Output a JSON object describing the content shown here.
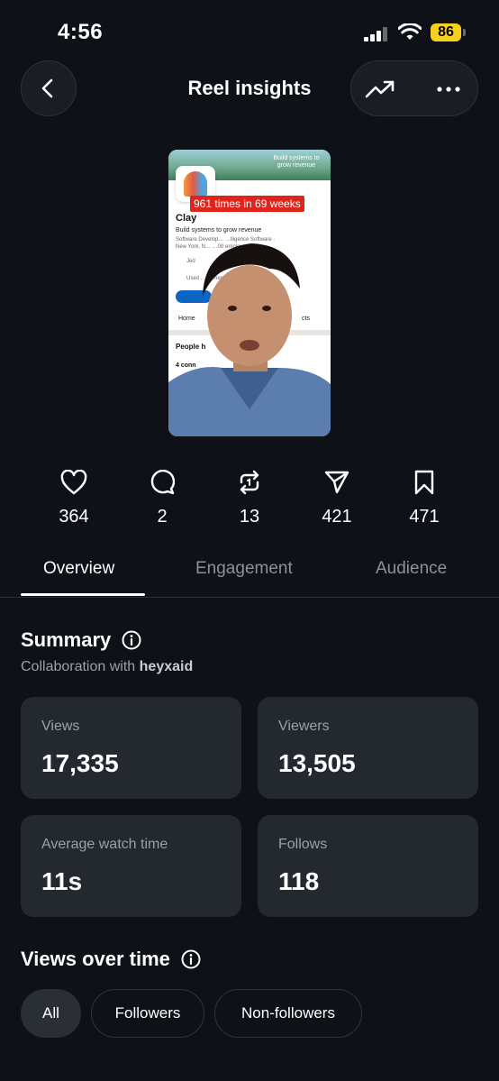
{
  "status_bar": {
    "time": "4:56",
    "battery": "86"
  },
  "header": {
    "title": "Reel insights",
    "back_icon": "chevron-left-icon",
    "trend_icon": "trending-up-icon",
    "more_icon": "more-horizontal-icon"
  },
  "thumbnail": {
    "banner_text": "Build systems to grow revenue",
    "badge": "961 times in 69 weeks",
    "company_name": "Clay",
    "tagline": "Build systems to grow revenue",
    "line1": "Software Develop… …lligence Software ·",
    "line2": "New York, N… …00 employees",
    "line3": "Jed",
    "line4": "Used … …mers",
    "tab_home": "Home",
    "tab_cts": "cts",
    "section": "People h",
    "connections": "4 conn"
  },
  "stats": [
    {
      "icon": "heart-icon",
      "value": "364"
    },
    {
      "icon": "comment-icon",
      "value": "2"
    },
    {
      "icon": "repost-icon",
      "value": "13"
    },
    {
      "icon": "send-icon",
      "value": "421"
    },
    {
      "icon": "bookmark-icon",
      "value": "471"
    }
  ],
  "tabs": [
    {
      "label": "Overview",
      "active": true
    },
    {
      "label": "Engagement",
      "active": false
    },
    {
      "label": "Audience",
      "active": false
    }
  ],
  "summary": {
    "title": "Summary",
    "collab_prefix": "Collaboration with",
    "collab_user": "heyxaid",
    "cards": [
      {
        "label": "Views",
        "value": "17,335"
      },
      {
        "label": "Viewers",
        "value": "13,505"
      },
      {
        "label": "Average watch time",
        "value": "11s"
      },
      {
        "label": "Follows",
        "value": "118"
      }
    ]
  },
  "views_over_time": {
    "title": "Views over time",
    "filters": [
      {
        "label": "All",
        "selected": true
      },
      {
        "label": "Followers",
        "selected": false
      },
      {
        "label": "Non-followers",
        "selected": false
      }
    ]
  },
  "colors": {
    "background": "#0e1117",
    "card": "#24282f",
    "battery": "#f5d01e",
    "badge": "#e0241c"
  }
}
